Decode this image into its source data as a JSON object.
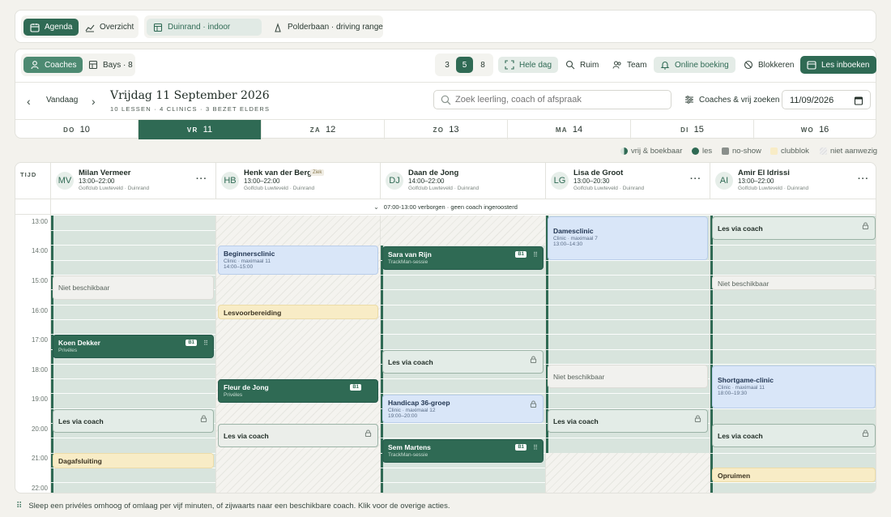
{
  "topbar": {
    "agenda": "Agenda",
    "overzicht": "Overzicht",
    "loc_indoor": "Duinrand · indoor",
    "loc_range": "Polderbaan · driving range"
  },
  "toolbar": {
    "coaches": "Coaches",
    "bays": "Bays · 8",
    "days": [
      "3",
      "5",
      "8"
    ],
    "hele_dag": "Hele dag",
    "ruim": "Ruim",
    "team": "Team",
    "online": "Online boeking",
    "blokkeren": "Blokkeren",
    "inboeken": "Les inboeken"
  },
  "datebar": {
    "vandaag": "Vandaag",
    "title": "Vrijdag 11 September 2026",
    "subtitle": "10 LESSEN · 4 CLINICS · 3 BEZET ELDERS",
    "search_placeholder": "Zoek leerling, coach of afspraak",
    "filter": "Coaches & vrij zoeken",
    "date_value": "11/09/2026"
  },
  "days": [
    {
      "name": "DO",
      "num": "10"
    },
    {
      "name": "VR",
      "num": "11"
    },
    {
      "name": "ZA",
      "num": "12"
    },
    {
      "name": "ZO",
      "num": "13"
    },
    {
      "name": "MA",
      "num": "14"
    },
    {
      "name": "DI",
      "num": "15"
    },
    {
      "name": "WO",
      "num": "16"
    }
  ],
  "legend": [
    "vrij & boekbaar",
    "les",
    "no-show",
    "clubblok",
    "niet aanwezig"
  ],
  "colors": {
    "accent": "#2f6a54",
    "clinic": "#d9e6f8",
    "club": "#f8ecc6",
    "avail": "#d8e4dd",
    "noshow": "#8a8f8b"
  },
  "grid": {
    "tijd": "TIJD",
    "hidden_note": "07:00-13:00 verborgen · geen coach ingeroosterd",
    "hours": [
      "13:00",
      "14:00",
      "15:00",
      "16:00",
      "17:00",
      "18:00",
      "19:00",
      "20:00",
      "21:00",
      "22:00"
    ]
  },
  "coaches": [
    {
      "initials": "MV",
      "name": "Milan Vermeer",
      "time": "13:00–22:00",
      "club": "Golfclub Luwteveld · Duinrand",
      "tag": ""
    },
    {
      "initials": "HB",
      "name": "Henk van der Berg",
      "time": "13:00–22:00",
      "club": "Golfclub Luwteveld · Duinrand",
      "tag": "Ziek"
    },
    {
      "initials": "DJ",
      "name": "Daan de Jong",
      "time": "14:00–22:00",
      "club": "Golfclub Luwteveld · Duinrand",
      "tag": ""
    },
    {
      "initials": "LG",
      "name": "Lisa de Groot",
      "time": "13:00–20:30",
      "club": "Golfclub Luwteveld · Duinrand",
      "tag": ""
    },
    {
      "initials": "AI",
      "name": "Amir El Idrissi",
      "time": "13:00–22:00",
      "club": "Golfclub Luwteveld · Duinrand",
      "tag": ""
    }
  ],
  "events": {
    "c0": [
      {
        "title": "Niet beschikbaar"
      },
      {
        "title": "Koen Dekker",
        "sub": "Privéles",
        "badge": "B1"
      },
      {
        "title": "Les via coach"
      },
      {
        "title": "Dagafsluiting"
      }
    ],
    "c1": [
      {
        "title": "Beginnersclinic",
        "sub": "Clinic · maximaal 11",
        "range": "14:00–15:00"
      },
      {
        "title": "Lesvoorbereiding"
      },
      {
        "title": "Fleur de Jong",
        "sub": "Privéles",
        "badge": "B1"
      },
      {
        "title": "Les via coach"
      }
    ],
    "c2": [
      {
        "title": "Sara van Rijn",
        "sub": "TrackMan-sessie",
        "badge": "B1"
      },
      {
        "title": "Les via coach"
      },
      {
        "title": "Handicap 36-groep",
        "sub": "Clinic · maximaal 12",
        "range": "19:00–20:00"
      },
      {
        "title": "Sem Martens",
        "sub": "TrackMan-sessie",
        "badge": "B1"
      }
    ],
    "c3": [
      {
        "title": "Damesclinic",
        "sub": "Clinic · maximaal 7",
        "range": "13:00–14:30"
      },
      {
        "title": "Niet beschikbaar"
      },
      {
        "title": "Les via coach"
      }
    ],
    "c4": [
      {
        "title": "Les via coach"
      },
      {
        "title": "Niet beschikbaar"
      },
      {
        "title": "Shortgame-clinic",
        "sub": "Clinic · maximaal 11",
        "range": "18:00–19:30"
      },
      {
        "title": "Les via coach"
      },
      {
        "title": "Opruimen"
      }
    ]
  },
  "footer": "Sleep een privéles omhoog of omlaag per vijf minuten, of zijwaarts naar een beschikbare coach. Klik voor de overige acties."
}
